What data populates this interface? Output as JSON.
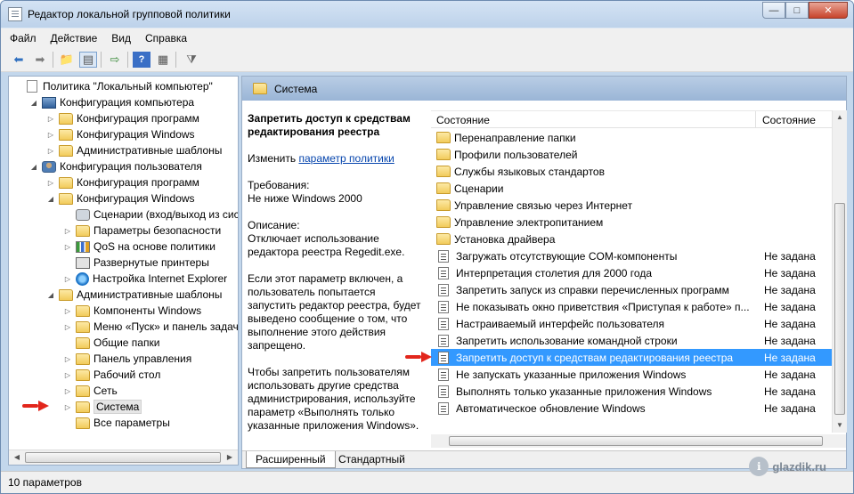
{
  "window": {
    "title": "Редактор локальной групповой политики",
    "min_glyph": "—",
    "max_glyph": "□",
    "close_glyph": "✕"
  },
  "menu": [
    "Файл",
    "Действие",
    "Вид",
    "Справка"
  ],
  "toolbar": {
    "icons": [
      "back-icon",
      "forward-icon",
      "up-folder-icon",
      "show-hide-tree-icon",
      "export-list-icon",
      "help-icon",
      "properties-icon",
      "filter-icon"
    ]
  },
  "tree": {
    "items": [
      {
        "label": "Политика \"Локальный компьютер\"",
        "icon": "policy-doc-icon",
        "level": 0,
        "arrow": ""
      },
      {
        "label": "Конфигурация компьютера",
        "icon": "computer-icon",
        "level": 1,
        "arrow": "◢"
      },
      {
        "label": "Конфигурация программ",
        "icon": "folder-icon",
        "level": 2,
        "arrow": "▷"
      },
      {
        "label": "Конфигурация Windows",
        "icon": "folder-icon",
        "level": 2,
        "arrow": "▷"
      },
      {
        "label": "Административные шаблоны",
        "icon": "folder-icon",
        "level": 2,
        "arrow": "▷"
      },
      {
        "label": "Конфигурация пользователя",
        "icon": "user-icon",
        "level": 1,
        "arrow": "◢"
      },
      {
        "label": "Конфигурация программ",
        "icon": "folder-icon",
        "level": 2,
        "arrow": "▷"
      },
      {
        "label": "Конфигурация Windows",
        "icon": "folder-icon",
        "level": 2,
        "arrow": "◢"
      },
      {
        "label": "Сценарии (вход/выход из систе",
        "icon": "script-icon",
        "level": 3,
        "arrow": ""
      },
      {
        "label": "Параметры безопасности",
        "icon": "folder-icon",
        "level": 3,
        "arrow": "▷"
      },
      {
        "label": "QoS на основе политики",
        "icon": "chart-icon",
        "level": 3,
        "arrow": "▷"
      },
      {
        "label": "Развернутые принтеры",
        "icon": "printer-icon",
        "level": 3,
        "arrow": ""
      },
      {
        "label": "Настройка Internet Explorer",
        "icon": "internet-explorer-icon",
        "level": 3,
        "arrow": "▷"
      },
      {
        "label": "Административные шаблоны",
        "icon": "folder-icon",
        "level": 2,
        "arrow": "◢"
      },
      {
        "label": "Компоненты Windows",
        "icon": "folder-icon",
        "level": 3,
        "arrow": "▷"
      },
      {
        "label": "Меню «Пуск» и панель задач",
        "icon": "folder-icon",
        "level": 3,
        "arrow": "▷"
      },
      {
        "label": "Общие папки",
        "icon": "folder-icon",
        "level": 3,
        "arrow": ""
      },
      {
        "label": "Панель управления",
        "icon": "folder-icon",
        "level": 3,
        "arrow": "▷"
      },
      {
        "label": "Рабочий стол",
        "icon": "folder-icon",
        "level": 3,
        "arrow": "▷"
      },
      {
        "label": "Сеть",
        "icon": "folder-icon",
        "level": 3,
        "arrow": "▷"
      },
      {
        "label": "Система",
        "icon": "folder-icon",
        "level": 3,
        "arrow": "▷",
        "selected": true
      },
      {
        "label": "Все параметры",
        "icon": "all-settings-icon",
        "level": 3,
        "arrow": ""
      }
    ]
  },
  "detail": {
    "header": "Система",
    "setting_title": "Запретить доступ к средствам редактирования реестра",
    "edit_prefix": "Изменить",
    "edit_link": "параметр политики",
    "requirements_label": "Требования:",
    "requirements_value": "Не ниже Windows 2000",
    "description_label": "Описание:",
    "description_1": "Отключает использование редактора реестра Regedit.exe.",
    "description_2": "Если этот параметр включен, а пользователь попытается запустить редактор реестра, будет выведено сообщение о том, что выполнение этого действия запрещено.",
    "description_3": "Чтобы запретить пользователям использовать другие средства администрирования, используйте параметр «Выполнять только указанные приложения Windows»."
  },
  "list": {
    "columns": [
      "Состояние",
      "Состояние"
    ],
    "rows": [
      {
        "name": "Перенаправление папки",
        "state": "",
        "type": "folder"
      },
      {
        "name": "Профили пользователей",
        "state": "",
        "type": "folder"
      },
      {
        "name": "Службы языковых стандартов",
        "state": "",
        "type": "folder"
      },
      {
        "name": "Сценарии",
        "state": "",
        "type": "folder"
      },
      {
        "name": "Управление связью через Интернет",
        "state": "",
        "type": "folder"
      },
      {
        "name": "Управление электропитанием",
        "state": "",
        "type": "folder"
      },
      {
        "name": "Установка драйвера",
        "state": "",
        "type": "folder"
      },
      {
        "name": "Загружать отсутствующие COM-компоненты",
        "state": "Не задана",
        "type": "setting"
      },
      {
        "name": "Интерпретация столетия для 2000 года",
        "state": "Не задана",
        "type": "setting"
      },
      {
        "name": "Запретить запуск из справки перечисленных программ",
        "state": "Не задана",
        "type": "setting"
      },
      {
        "name": "Не показывать окно приветствия «Приступая к работе» п...",
        "state": "Не задана",
        "type": "setting"
      },
      {
        "name": "Настраиваемый интерфейс пользователя",
        "state": "Не задана",
        "type": "setting"
      },
      {
        "name": "Запретить использование командной строки",
        "state": "Не задана",
        "type": "setting"
      },
      {
        "name": "Запретить доступ к средствам редактирования реестра",
        "state": "Не задана",
        "type": "setting",
        "selected": true
      },
      {
        "name": "Не запускать указанные приложения Windows",
        "state": "Не задана",
        "type": "setting"
      },
      {
        "name": "Выполнять только указанные приложения Windows",
        "state": "Не задана",
        "type": "setting"
      },
      {
        "name": "Автоматическое обновление Windows",
        "state": "Не задана",
        "type": "setting"
      }
    ]
  },
  "tabs": [
    "Расширенный",
    "Стандартный"
  ],
  "status": "10 параметров",
  "watermark": "glazdik.ru",
  "colors": {
    "selection": "#3399ff",
    "pointer_arrow": "#e2261c"
  }
}
